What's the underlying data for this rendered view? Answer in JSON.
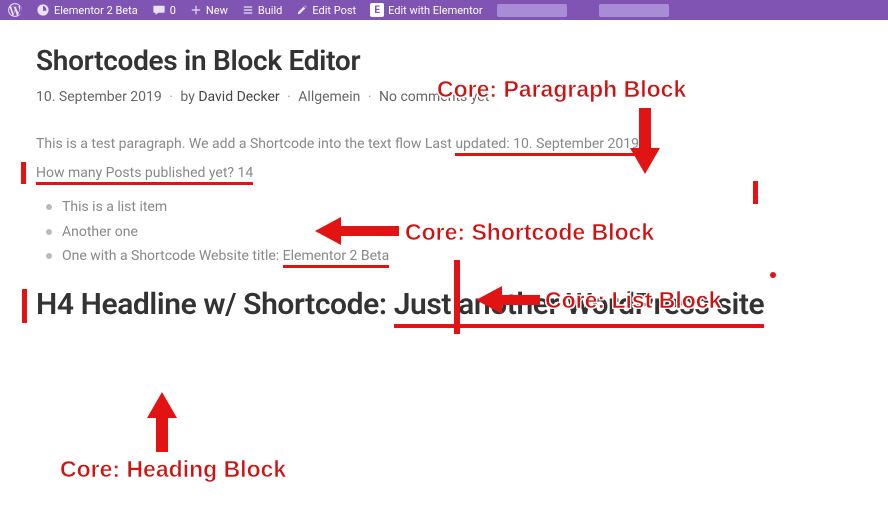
{
  "adminbar": {
    "site_name": "Elementor 2 Beta",
    "comments_count": "0",
    "new_label": "New",
    "build_label": "Build",
    "edit_post_label": "Edit Post",
    "edit_elementor_label": "Edit with Elementor"
  },
  "post": {
    "title": "Shortcodes in Block Editor",
    "date": "10. September 2019",
    "by_label": "by",
    "author": "David Decker",
    "category": "Allgemein",
    "comments": "No comments yet"
  },
  "para": {
    "prefix": "This is a test paragraph. We add a Shortcode into the text flow Last ",
    "underlined": "updated: 10. September 2019"
  },
  "shortcode": {
    "text": "How many Posts published yet? 14"
  },
  "list": {
    "i0": "This is a list item",
    "i1": "Another one",
    "i2_prefix": "One with a Shortcode Website title: ",
    "i2_underlined": "Elementor 2 Beta"
  },
  "h4": {
    "prefix": "H4 Headline w/ Shortcode: ",
    "underlined": "Just another WordPress site"
  },
  "annotations": {
    "paragraph": "Core: Paragraph Block",
    "shortcode": "Core: Shortcode Block",
    "list": "Core: List Block",
    "heading": "Core: Heading Block"
  }
}
